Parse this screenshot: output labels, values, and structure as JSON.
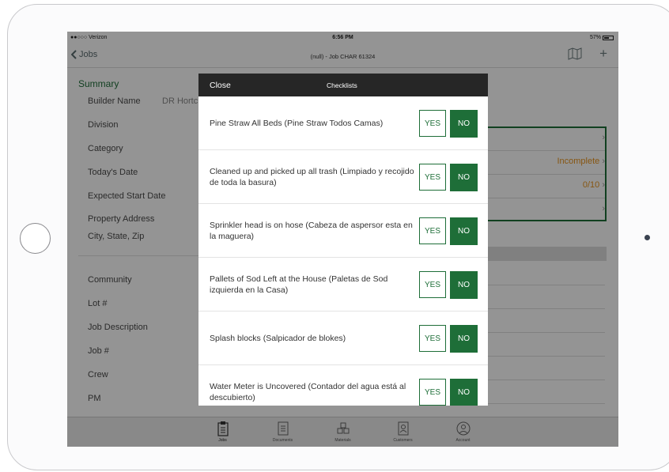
{
  "status_bar": {
    "carrier": "●●○○○ Verizon",
    "time": "6:56 PM",
    "battery": "57%"
  },
  "nav": {
    "back_label": "Jobs",
    "title": "(null) - Job CHAR 61324"
  },
  "form": {
    "section_title": "Summary",
    "fields": [
      {
        "label": "Builder Name",
        "value": "DR Hortc"
      },
      {
        "label": "Division"
      },
      {
        "label": "Category"
      },
      {
        "label": "Today's Date"
      },
      {
        "label": "Expected Start Date"
      },
      {
        "label": "Property Address"
      },
      {
        "label": "City, State, Zip"
      },
      {
        "label": "Community"
      },
      {
        "label": "Lot #"
      },
      {
        "label": "Job Description"
      },
      {
        "label": "Job #"
      },
      {
        "label": "Crew"
      },
      {
        "label": "PM"
      }
    ],
    "right_rows": [
      {
        "text": ""
      },
      {
        "text": "Incomplete",
        "color": "#e8951f"
      },
      {
        "text": "0/10",
        "color": "#e8951f"
      },
      {
        "text": ""
      }
    ]
  },
  "modal": {
    "close_label": "Close",
    "title": "Checklists",
    "items": [
      {
        "question": "Pine Straw All Beds (Pine Straw Todos Camas)",
        "yes": "YES",
        "no": "NO"
      },
      {
        "question": "Cleaned up and picked up all trash (Limpiado y recojido de toda la basura)",
        "yes": "YES",
        "no": "NO"
      },
      {
        "question": "Sprinkler head is on hose (Cabeza de aspersor esta en la maguera)",
        "yes": "YES",
        "no": "NO"
      },
      {
        "question": "Pallets of Sod Left at the House (Paletas de Sod izquierda en la Casa)",
        "yes": "YES",
        "no": "NO"
      },
      {
        "question": "Splash blocks (Salpicador de blokes)",
        "yes": "YES",
        "no": "NO"
      },
      {
        "question": "Water Meter is Uncovered (Contador del agua está al descubierto)",
        "yes": "YES",
        "no": "NO"
      }
    ]
  },
  "tabs": [
    {
      "label": "Jobs",
      "icon": "clipboard-icon"
    },
    {
      "label": "Documents",
      "icon": "document-icon"
    },
    {
      "label": "Materials",
      "icon": "boxes-icon"
    },
    {
      "label": "Customers",
      "icon": "contact-card-icon"
    },
    {
      "label": "Account",
      "icon": "user-circle-icon"
    }
  ],
  "colors": {
    "accent": "#1e6e38",
    "warning": "#e8951f",
    "modal_header": "#262626"
  }
}
